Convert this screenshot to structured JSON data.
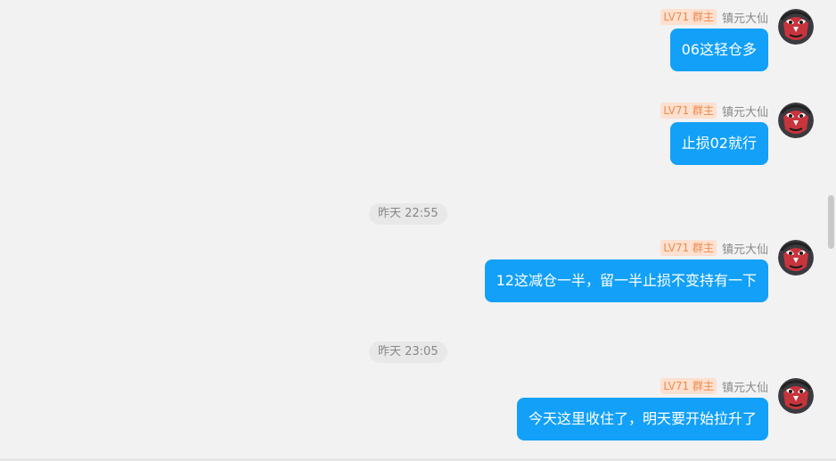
{
  "messages": [
    {
      "level_badge": "LV71 群主",
      "sender": "镇元大仙",
      "text": "06这轻仓多"
    },
    {
      "level_badge": "LV71 群主",
      "sender": "镇元大仙",
      "text": "止损02就行"
    },
    {
      "level_badge": "LV71 群主",
      "sender": "镇元大仙",
      "text": "12这减仓一半，留一半止损不变持有一下"
    },
    {
      "level_badge": "LV71 群主",
      "sender": "镇元大仙",
      "text": "今天这里收住了，明天要开始拉升了"
    }
  ],
  "timestamps": [
    "昨天 22:55",
    "昨天 23:05"
  ],
  "colors": {
    "bubble": "#12a0f8",
    "badge_bg": "#fde0cf",
    "badge_text": "#f08a4b",
    "background": "#f2f2f2"
  },
  "icons": {
    "avatar": "opera-mask-avatar-icon"
  }
}
